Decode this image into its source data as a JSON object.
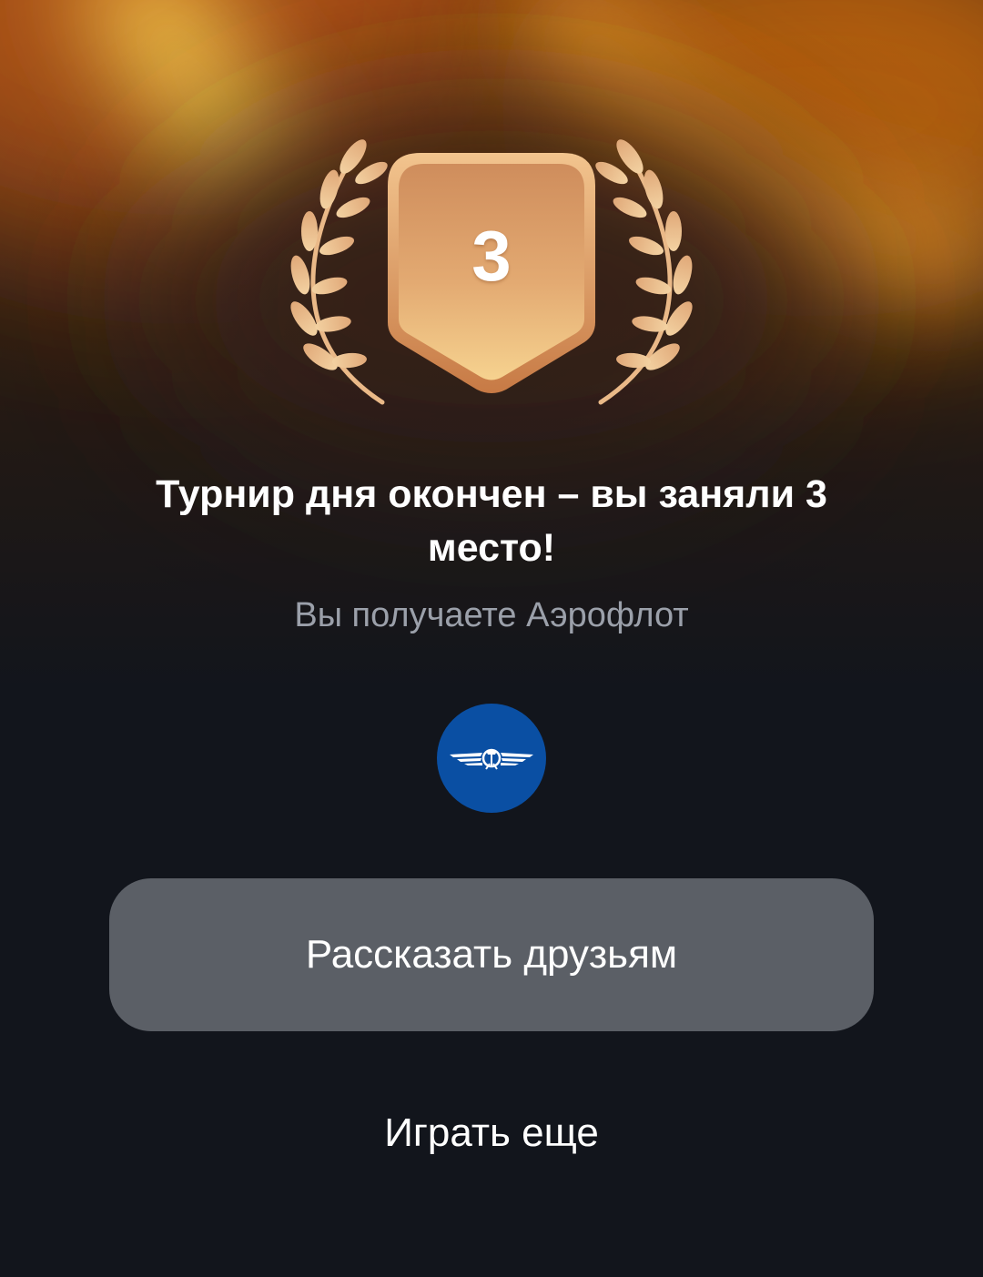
{
  "result": {
    "place": "3",
    "title": "Турнир дня окончен – вы заняли 3 место!",
    "subtitle": "Вы получаете Аэрофлот"
  },
  "prize": {
    "logo_icon": "aeroflot-winged-emblem-icon",
    "logo_background_color": "#0a4fa3"
  },
  "actions": {
    "share_label": "Рассказать друзьям",
    "play_again_label": "Играть еще"
  },
  "colors": {
    "background": "#12151c",
    "glow": "#f5a623",
    "bronze": "#d9955a",
    "button": "#5b5f66"
  }
}
